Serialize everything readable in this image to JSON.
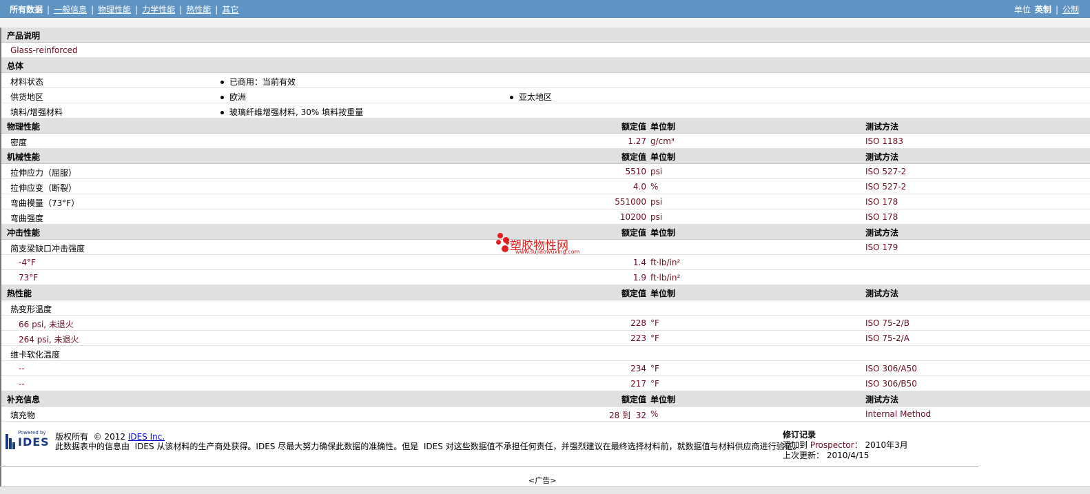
{
  "nav": {
    "items": [
      "所有数据",
      "一般信息",
      "物理性能",
      "力学性能",
      "热性能",
      "其它"
    ],
    "unit_label": "单位",
    "unit_options": [
      "英制",
      "公制"
    ]
  },
  "headers": {
    "value": "额定值",
    "unit": "单位制",
    "test": "测试方法"
  },
  "product": {
    "title": "产品说明",
    "desc": "Glass-reinforced"
  },
  "general": {
    "title": "总体",
    "rows": [
      {
        "name": "材料状态",
        "v1": "已商用：当前有效",
        "v2": ""
      },
      {
        "name": "供货地区",
        "v1": "欧洲",
        "v2": "亚太地区"
      },
      {
        "name": "填料/增强材料",
        "v1": "玻璃纤维增强材料, 30% 填料按重量",
        "v2": ""
      }
    ]
  },
  "physical": {
    "title": "物理性能",
    "rows": [
      {
        "name": "密度",
        "value": "1.27",
        "unit": "g/cm³",
        "test": "ISO 1183"
      }
    ]
  },
  "mechanical": {
    "title": "机械性能",
    "rows": [
      {
        "name": "拉伸应力（屈服）",
        "value": "5510",
        "unit": "psi",
        "test": "ISO 527-2"
      },
      {
        "name": "拉伸应变（断裂）",
        "value": "4.0",
        "unit": "%",
        "test": "ISO 527-2"
      },
      {
        "name": "弯曲模量（73°F）",
        "value": "551000",
        "unit": "psi",
        "test": "ISO 178"
      },
      {
        "name": "弯曲强度",
        "value": "10200",
        "unit": "psi",
        "test": "ISO 178"
      }
    ]
  },
  "impact": {
    "title": "冲击性能",
    "group": "简支梁缺口冲击强度",
    "group_test": "ISO 179",
    "rows": [
      {
        "name": "-4°F",
        "value": "1.4",
        "unit": "ft·lb/in²"
      },
      {
        "name": "73°F",
        "value": "1.9",
        "unit": "ft·lb/in²"
      }
    ]
  },
  "thermal": {
    "title": "热性能",
    "group1": "热变形温度",
    "group1_rows": [
      {
        "name": "66 psi, 未退火",
        "value": "228",
        "unit": "°F",
        "test": "ISO 75-2/B"
      },
      {
        "name": "264 psi, 未退火",
        "value": "223",
        "unit": "°F",
        "test": "ISO 75-2/A"
      }
    ],
    "group2": "维卡软化温度",
    "group2_rows": [
      {
        "name": "--",
        "value": "234",
        "unit": "°F",
        "test": "ISO 306/A50"
      },
      {
        "name": "--",
        "value": "217",
        "unit": "°F",
        "test": "ISO 306/B50"
      }
    ]
  },
  "extra": {
    "title": "补充信息",
    "rows": [
      {
        "name": "填充物",
        "value": "28 到  32",
        "unit": "%",
        "test": "Internal Method"
      }
    ]
  },
  "watermark": {
    "text": "塑胶物性网",
    "url": "www.sujiaowuxing.com"
  },
  "footer": {
    "logo_small": "Powered by",
    "logo": "IDES",
    "copyright": "版权所有  © 2012",
    "company": "IDES Inc.",
    "disclaimer": "此数据表中的信息由  IDES 从该材料的生产商处获得。IDES 尽最大努力确保此数据的准确性。但是  IDES 对这些数据值不承担任何责任，并强烈建议在最终选择材料前，就数据值与材料供应商进行验证。",
    "rev_title": "修订记录",
    "added_label": "添加到",
    "added_to": "Prospector：",
    "added_date": "2010年3月",
    "updated_label": "上次更新：",
    "updated_date": "2010/4/15"
  },
  "ad": "<广告>"
}
